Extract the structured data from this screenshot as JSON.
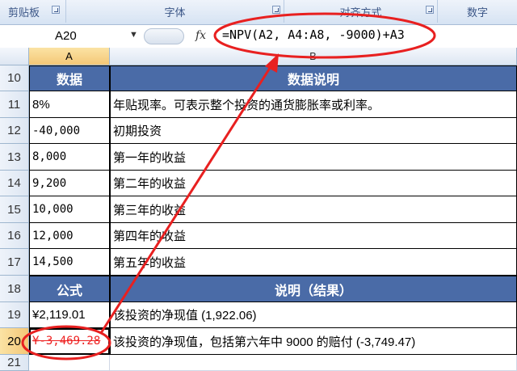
{
  "ribbon": {
    "clipboard": "剪贴板",
    "font": "字体",
    "alignment": "对齐方式",
    "number": "数字"
  },
  "formula_bar": {
    "name_box": "A20",
    "fx": "fx",
    "formula": "=NPV(A2, A4:A8, -9000)+A3"
  },
  "columns": [
    "A",
    "B"
  ],
  "rows": [
    {
      "num": "10",
      "a": "数据",
      "b": "数据说明"
    },
    {
      "num": "11",
      "a": "8%",
      "b": "年贴现率。可表示整个投资的通货膨胀率或利率。"
    },
    {
      "num": "12",
      "a": "-40,000",
      "b": "初期投资"
    },
    {
      "num": "13",
      "a": "8,000",
      "b": "第一年的收益"
    },
    {
      "num": "14",
      "a": "9,200",
      "b": "第二年的收益"
    },
    {
      "num": "15",
      "a": "10,000",
      "b": "第三年的收益"
    },
    {
      "num": "16",
      "a": "12,000",
      "b": "第四年的收益"
    },
    {
      "num": "17",
      "a": "14,500",
      "b": "第五年的收益"
    },
    {
      "num": "18",
      "a": "公式",
      "b": "说明（结果）"
    },
    {
      "num": "19",
      "a": "¥2,119.01",
      "b": "该投资的净现值 (1,922.06)"
    },
    {
      "num": "20",
      "a": "¥-3,469.28",
      "b": "该投资的净现值，包括第六年中 9000 的赔付 (-3,749.47)"
    },
    {
      "num": "21",
      "a": "",
      "b": ""
    }
  ],
  "colors": {
    "header_fill": "#4a6ba7",
    "annotation": "#e82020"
  }
}
